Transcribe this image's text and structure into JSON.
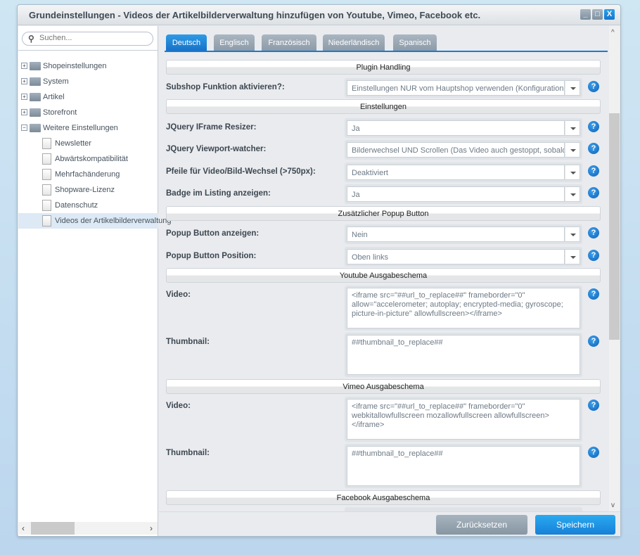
{
  "window": {
    "title": "Grundeinstellungen - Videos der Artikelbilderverwaltung hinzufügen von Youtube, Vimeo, Facebook etc.",
    "controls": [
      "minimize-icon",
      "maximize-icon",
      "close-icon"
    ]
  },
  "sidebar": {
    "search_placeholder": "Suchen...",
    "tree": [
      {
        "label": "Shopeinstellungen",
        "type": "folder",
        "expanded": false
      },
      {
        "label": "System",
        "type": "folder",
        "expanded": false
      },
      {
        "label": "Artikel",
        "type": "folder",
        "expanded": false
      },
      {
        "label": "Storefront",
        "type": "folder",
        "expanded": false
      },
      {
        "label": "Weitere Einstellungen",
        "type": "folder",
        "expanded": true
      },
      {
        "label": "Newsletter",
        "type": "leaf"
      },
      {
        "label": "Abwärtskompatibilität",
        "type": "leaf"
      },
      {
        "label": "Mehrfachänderung",
        "type": "leaf"
      },
      {
        "label": "Shopware-Lizenz",
        "type": "leaf"
      },
      {
        "label": "Datenschutz",
        "type": "leaf"
      },
      {
        "label": "Videos der Artikelbilderverwaltung",
        "type": "leaf",
        "selected": true
      }
    ]
  },
  "tabs": [
    {
      "label": "Deutsch",
      "active": true
    },
    {
      "label": "Englisch"
    },
    {
      "label": "Französisch"
    },
    {
      "label": "Niederländisch"
    },
    {
      "label": "Spanisch"
    }
  ],
  "form": {
    "sections": [
      "Plugin Handling",
      "Einstellungen",
      "Zusätzlicher Popup Button",
      "Youtube Ausgabeschema",
      "Vimeo Ausgabeschema",
      "Facebook Ausgabeschema"
    ],
    "fields": [
      {
        "label": "Subshop Funktion aktivieren?:",
        "value": "Einstellungen NUR vom Hauptshop verwenden (Konfigurationen"
      },
      {
        "label": "JQuery IFrame Resizer:",
        "value": "Ja"
      },
      {
        "label": "JQuery Viewport-watcher:",
        "value": "Bilderwechsel UND Scrollen (Das Video auch gestoppt, sobald"
      },
      {
        "label": "Pfeile für Video/Bild-Wechsel (>750px):",
        "value": "Deaktiviert"
      },
      {
        "label": "Badge im Listing anzeigen:",
        "value": "Ja"
      },
      {
        "label": "Popup Button anzeigen:",
        "value": "Nein"
      },
      {
        "label": "Popup Button Position:",
        "value": "Oben links"
      }
    ],
    "youtube": {
      "video_label": "Video:",
      "video": "<iframe src=\"##url_to_replace##\" frameborder=\"0\" allow=\"accelerometer; autoplay; encrypted-media; gyroscope; picture-in-picture\" allowfullscreen></iframe>",
      "thumb_label": "Thumbnail:",
      "thumb": "##thumbnail_to_replace##"
    },
    "vimeo": {
      "video_label": "Video:",
      "video": "<iframe src=\"##url_to_replace##\" frameborder=\"0\" webkitallowfullscreen mozallowfullscreen allowfullscreen></iframe>",
      "thumb_label": "Thumbnail:",
      "thumb": "##thumbnail_to_replace##"
    },
    "help_icon": "?"
  },
  "footer": {
    "reset": "Zurücksetzen",
    "save": "Speichern"
  },
  "colors": {
    "accent": "#1b7bd0",
    "save": "#1e8fe2",
    "reset": "#95a3af"
  }
}
